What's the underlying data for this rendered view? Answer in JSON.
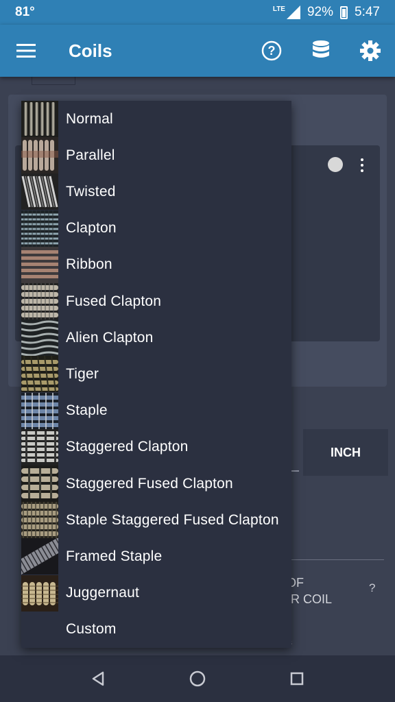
{
  "status": {
    "temp": "81°",
    "network": "LTE",
    "battery": "92%",
    "time": "5:47"
  },
  "appbar": {
    "title": "Coils",
    "icons": [
      "menu-icon",
      "help-icon",
      "database-icon",
      "settings-icon"
    ]
  },
  "background": {
    "inch_label": "INCH",
    "coil_text_line1": "R OF",
    "coil_text_line2": "PER COIL",
    "help_mark": "?",
    "small_text": "s"
  },
  "dropdown": {
    "items": [
      {
        "label": "Normal"
      },
      {
        "label": "Parallel"
      },
      {
        "label": "Twisted"
      },
      {
        "label": "Clapton"
      },
      {
        "label": "Ribbon"
      },
      {
        "label": "Fused Clapton"
      },
      {
        "label": "Alien Clapton"
      },
      {
        "label": "Tiger"
      },
      {
        "label": "Staple"
      },
      {
        "label": "Staggered Clapton"
      },
      {
        "label": "Staggered Fused Clapton"
      },
      {
        "label": "Staple Staggered Fused Clapton"
      },
      {
        "label": "Framed Staple"
      },
      {
        "label": "Juggernaut"
      },
      {
        "label": "Custom"
      }
    ]
  },
  "navbar": {
    "icons": [
      "back-icon",
      "home-icon",
      "recents-icon"
    ]
  },
  "colors": {
    "appbar": "#2f80b5",
    "background": "#3b4152",
    "menu": "#2b3040"
  }
}
